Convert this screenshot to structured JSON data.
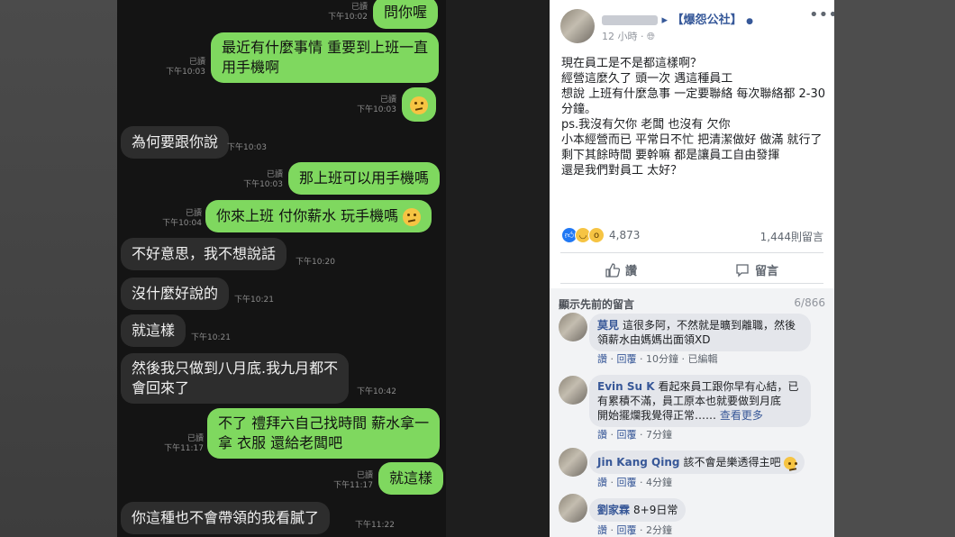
{
  "chat": {
    "m1": {
      "text": "問你喔",
      "read": "已讀",
      "time": "下午10:02"
    },
    "m2": {
      "line1": "最近有什麼事情 重要到上班一直",
      "line2": "用手機啊",
      "read": "已讀",
      "time": "下午10:03"
    },
    "m3": {
      "read": "已讀",
      "time": "下午10:03"
    },
    "m4": {
      "text": "為何要跟你說",
      "time": "下午10:03"
    },
    "m5": {
      "text": "那上班可以用手機嗎",
      "read": "已讀",
      "time": "下午10:03"
    },
    "m6": {
      "text": "你來上班 付你薪水 玩手機嗎",
      "read": "已讀",
      "time": "下午10:04"
    },
    "m7": {
      "text": "不好意思，我不想說話",
      "time": "下午10:20"
    },
    "m8": {
      "text": "沒什麼好說的",
      "time": "下午10:21"
    },
    "m9": {
      "text": "就這樣",
      "time": "下午10:21"
    },
    "m10": {
      "line1": "然後我只做到八月底.我九月都不",
      "line2": "會回來了",
      "time": "下午10:42"
    },
    "m11": {
      "line1": "不了 禮拜六自己找時間 薪水拿一",
      "line2": "拿 衣服 還給老闆吧",
      "read": "已讀",
      "time": "下午11:17"
    },
    "m12": {
      "text": "就這樣",
      "read": "已讀",
      "time": "下午11:17"
    },
    "m13": {
      "text": "你這種也不會帶領的我看膩了",
      "time": "下午11:22"
    }
  },
  "post": {
    "group": "▸ 【爆怨公社】",
    "time": "12 小時",
    "body": "現在員工是不是都這樣啊？\n經營這麼久了 頭一次 遇這種員工\n想說 上班有什麼急事 一定要聯絡 每次聯絡都 2-30分鐘。\nps.我沒有欠你 老闆 也沒有 欠你\n小本經營而已 平常日不忙 把清潔做好 做滿 就行了\n剩下其餘時間 要幹嘛 都是讓員工自由發揮\n還是我們對員工 太好？",
    "reaction_count": "4,873",
    "comment_count": "1,444則留言",
    "like_label": "讚",
    "comment_label": "留言",
    "prev_comments": "顯示先前的留言",
    "page_count": "6/866"
  },
  "comments": [
    {
      "name": "莫見",
      "line1": "這很多阿，不然就是曠到離職，然後",
      "line2": "領薪水由媽媽出面領XD",
      "like": "讚",
      "reply": "回覆",
      "time": "10分鐘",
      "edited": "已編輯"
    },
    {
      "name": "Evin Su K",
      "line1": "看起來員工跟你早有心結，已",
      "line2": "有累積不滿，員工原本也就要做到月底",
      "line3": "開始擺爛我覺得正常……",
      "more": "查看更多",
      "like": "讚",
      "reply": "回覆",
      "time": "7分鐘"
    },
    {
      "name": "Jin Kang Qing",
      "text": "該不會是樂透得主吧",
      "like": "讚",
      "reply": "回覆",
      "time": "4分鐘"
    },
    {
      "name": "劉家霖",
      "text": "8+9日常",
      "like": "讚",
      "reply": "回覆",
      "time": "2分鐘"
    }
  ],
  "colors": {
    "outgoing": "#7fd85f",
    "incoming": "#2d2d2d",
    "fb_link": "#365899"
  },
  "icons": [
    "thinking-emoji",
    "like-reaction-icon",
    "haha-reaction-icon",
    "wow-reaction-icon",
    "thumbs-up-icon",
    "comment-icon",
    "globe-icon",
    "more-options-icon"
  ]
}
